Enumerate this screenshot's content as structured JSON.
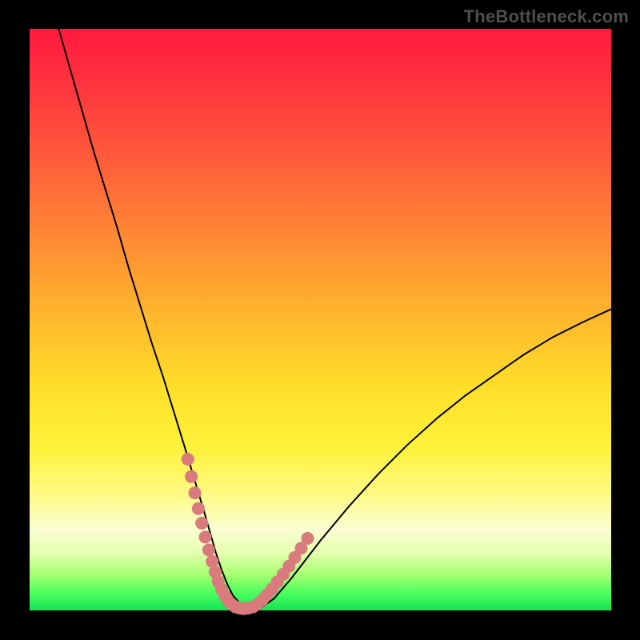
{
  "watermark": "TheBottleneck.com",
  "chart_data": {
    "type": "line",
    "title": "",
    "xlabel": "",
    "ylabel": "",
    "xlim": [
      0,
      100
    ],
    "ylim": [
      0,
      100
    ],
    "grid": false,
    "legend": false,
    "series": [
      {
        "name": "curve",
        "x": [
          5,
          7,
          9,
          11,
          13,
          15,
          17,
          19,
          21,
          23,
          25,
          27,
          28.5,
          30,
          31,
          32,
          33,
          34,
          35,
          36,
          37,
          38.5,
          40,
          42,
          45,
          50,
          55,
          60,
          65,
          70,
          75,
          80,
          85,
          90,
          95,
          100
        ],
        "y": [
          100,
          93,
          86,
          79,
          72.5,
          66,
          59,
          52.5,
          46,
          40,
          33.5,
          27,
          22,
          17,
          13.5,
          10,
          7,
          4.5,
          2.5,
          1.4,
          0.6,
          0.2,
          0.6,
          2,
          5.5,
          12,
          18,
          23.5,
          28.5,
          33,
          37,
          40.5,
          44,
          47,
          49.5,
          51.8
        ]
      }
    ],
    "markers": {
      "name": "pink-dots",
      "color": "#d97a7d",
      "x": [
        27.2,
        27.8,
        28.4,
        29.0,
        29.6,
        30.2,
        30.8,
        31.4,
        31.9,
        32.4,
        33.0,
        33.6,
        34.2,
        34.8,
        35.4,
        36.1,
        36.8,
        37.6,
        38.4,
        39.2,
        40.0,
        40.8,
        41.7,
        42.6,
        43.6,
        44.6,
        45.6,
        46.7,
        47.8
      ],
      "y": [
        26.0,
        23.0,
        20.2,
        17.5,
        15.0,
        12.6,
        10.4,
        8.4,
        6.6,
        5.0,
        3.6,
        2.5,
        1.6,
        1.0,
        0.6,
        0.4,
        0.3,
        0.4,
        0.6,
        1.1,
        1.8,
        2.7,
        3.7,
        4.9,
        6.2,
        7.6,
        9.1,
        10.7,
        12.4
      ]
    },
    "gradient_colors": {
      "top": "#ff1a3d",
      "mid_upper": "#ff8a33",
      "mid": "#ffe029",
      "mid_lower": "#fafed2",
      "bottom": "#13e455"
    }
  }
}
